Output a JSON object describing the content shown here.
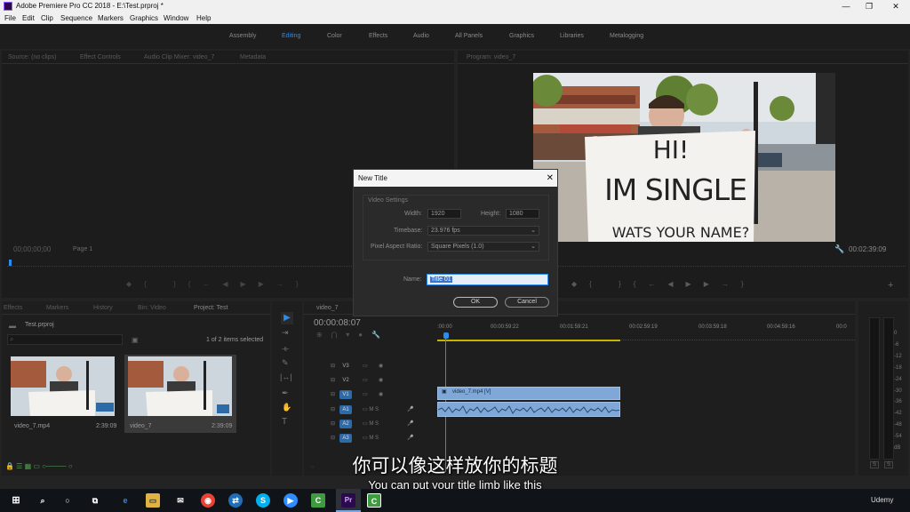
{
  "titlebar": {
    "title": "Adobe Premiere Pro CC 2018 - E:\\Test.prproj *",
    "minimize": "—",
    "maximize": "❐",
    "close": "✕"
  },
  "menu": [
    "File",
    "Edit",
    "Clip",
    "Sequence",
    "Markers",
    "Graphics",
    "Window",
    "Help"
  ],
  "workspaces": [
    "Assembly",
    "Editing",
    "Color",
    "Effects",
    "Audio",
    "All Panels",
    "Graphics",
    "Libraries",
    "Metalogging"
  ],
  "source": {
    "tabs": [
      "Source: (no clips)",
      "Effect Controls",
      "Audio Clip Mixer: video_7",
      "Metadata"
    ],
    "timecode": "00;00;00;00",
    "page": "Page 1"
  },
  "program": {
    "tab": "Program: video_7",
    "timecode": "00:02:39:09",
    "sign_line1": "HI!",
    "sign_line2": "IM SINGLE",
    "sign_line3": "WATS YOUR NAME?"
  },
  "project": {
    "tabs": [
      "Effects",
      "Markers",
      "History",
      "Bin: Video",
      "Project: Test"
    ],
    "file": "Test.prproj",
    "items_status": "1 of 2 items selected",
    "items": [
      {
        "name": "video_7.mp4",
        "duration": "2:39:09"
      },
      {
        "name": "video_7",
        "duration": "2:39:09"
      }
    ]
  },
  "timeline": {
    "tab": "video_7",
    "timecode": "00:00:08:07",
    "ruler": [
      ":00:00",
      "00:00:59:22",
      "00:01:59:21",
      "00:02:59:19",
      "00:03:59:18",
      "00:04:59:16",
      "00:0"
    ],
    "tracks": [
      "V3",
      "V2",
      "V1",
      "A1",
      "A2",
      "A3"
    ],
    "clip_label": "video_7.mp4 [V]"
  },
  "meters": {
    "scale": [
      "0",
      "-6",
      "-12",
      "-18",
      "-24",
      "-30",
      "-36",
      "-42",
      "-48",
      "-54",
      "dB"
    ],
    "solo": [
      "S",
      "S"
    ]
  },
  "dialog": {
    "title": "New Title",
    "close": "✕",
    "section": "Video Settings",
    "width_label": "Width:",
    "width_value": "1920",
    "height_label": "Height:",
    "height_value": "1080",
    "timebase_label": "Timebase:",
    "timebase_value": "23.976 fps",
    "par_label": "Pixel Aspect Ratio:",
    "par_value": "Square Pixels (1.0)",
    "name_label": "Name:",
    "name_value": "Title 01",
    "ok": "OK",
    "cancel": "Cancel"
  },
  "subtitles": {
    "zh": "你可以像这样放你的标题",
    "en": "You can put your title limb like this"
  },
  "taskbar": {
    "watermark": "Udemy"
  },
  "colors": {
    "accent_blue": "#2d8ceb",
    "clip_blue": "#7fa8d8",
    "premiere_purple": "#2a0a4a"
  }
}
